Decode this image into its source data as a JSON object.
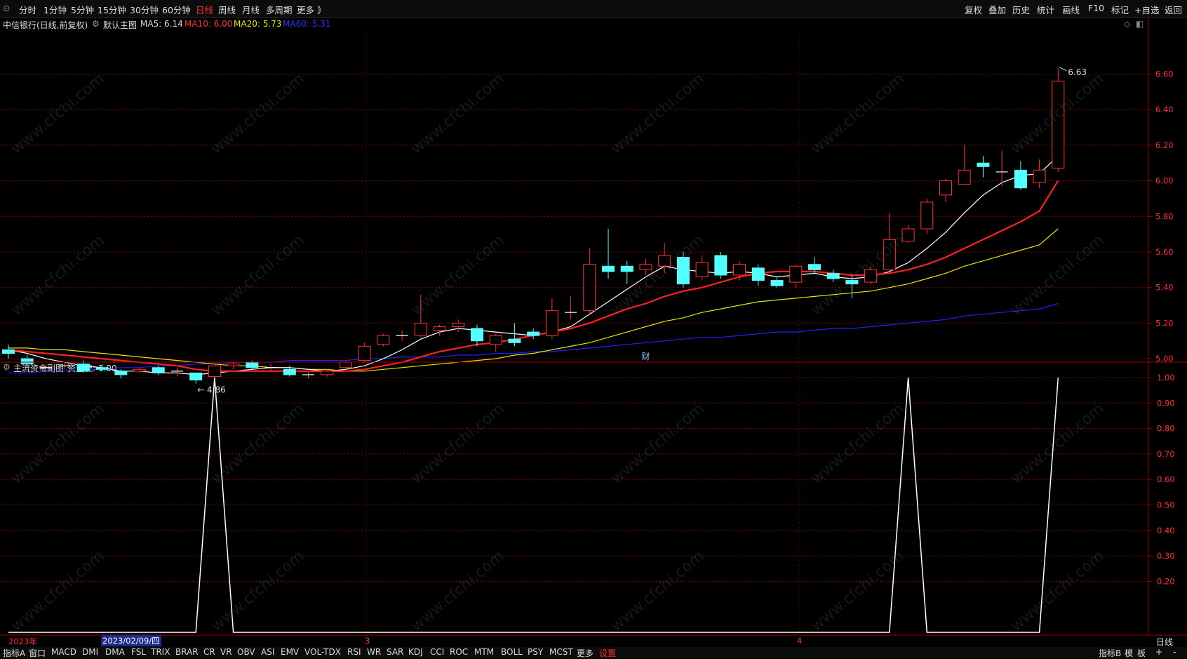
{
  "toolbar": {
    "left_tabs": [
      "分时",
      "1分钟",
      "5分钟",
      "15分钟",
      "30分钟",
      "60分钟",
      "日线",
      "周线",
      "月线",
      "多周期",
      "更多 》"
    ],
    "active_tab": "日线",
    "right_tabs": [
      "复权",
      "叠加",
      "历史",
      "统计",
      "画线",
      "F10",
      "标记",
      "+自选",
      "返回"
    ]
  },
  "main_info": {
    "stock": "中信银行(日线,前复权)",
    "chart_name": "默认主图",
    "ma5": "MA5: 6.14",
    "ma10": "MA10: 6.00",
    "ma20": "MA20: 5.73",
    "ma60": "MA60: 5.31"
  },
  "sub_info": {
    "name": "主流资金副图",
    "value": "资金流: 1.00"
  },
  "annotations": {
    "high": "6.63",
    "low": "4.86",
    "cai": "财"
  },
  "date_axis": {
    "year_label": "2023年",
    "cursor_date": "2023/02/09/四",
    "month_3": "3",
    "month_4": "4",
    "period": "日线"
  },
  "bottom_tabs": [
    "指标A",
    "窗口",
    "MACD",
    "DMI",
    "DMA",
    "FSL",
    "TRIX",
    "BRAR",
    "CR",
    "VR",
    "OBV",
    "ASI",
    "EMV",
    "VOL-TDX",
    "RSI",
    "WR",
    "SAR",
    "KDJ",
    "CCI",
    "ROC",
    "MTM",
    "BOLL",
    "PSY",
    "MCST",
    "更多",
    "设置"
  ],
  "bottom_right_tabs": [
    "指标B",
    "模",
    "板",
    "+",
    "-"
  ],
  "watermark": "www.cfchi.com",
  "colors": {
    "up": "#ff3232",
    "down": "#54ffff",
    "ma5": "#ffffff",
    "ma10": "#ff2020",
    "ma20": "#e6e600",
    "ma60": "#2020ff",
    "grid": "#8a0000"
  },
  "chart_data": [
    {
      "type": "candlestick",
      "title": "中信银行(日线,前复权)",
      "y_ticks": [
        "6.60",
        "6.40",
        "6.20",
        "6.00",
        "5.80",
        "5.60",
        "5.40",
        "5.20",
        "5.00"
      ],
      "ylim": [
        4.84,
        6.64
      ],
      "candles": [
        {
          "o": 5.05,
          "h": 5.08,
          "l": 5.0,
          "c": 5.03
        },
        {
          "o": 5.0,
          "h": 5.02,
          "l": 4.96,
          "c": 4.97
        },
        {
          "o": 4.95,
          "h": 4.97,
          "l": 4.93,
          "c": 4.95
        },
        {
          "o": 4.96,
          "h": 4.98,
          "l": 4.94,
          "c": 4.96
        },
        {
          "o": 4.97,
          "h": 4.99,
          "l": 4.92,
          "c": 4.93
        },
        {
          "o": 4.95,
          "h": 4.97,
          "l": 4.93,
          "c": 4.94
        },
        {
          "o": 4.93,
          "h": 4.94,
          "l": 4.89,
          "c": 4.91
        },
        {
          "o": 4.93,
          "h": 4.95,
          "l": 4.92,
          "c": 4.94
        },
        {
          "o": 4.95,
          "h": 4.96,
          "l": 4.91,
          "c": 4.92
        },
        {
          "o": 4.93,
          "h": 4.95,
          "l": 4.9,
          "c": 4.93
        },
        {
          "o": 4.92,
          "h": 4.92,
          "l": 4.86,
          "c": 4.88
        },
        {
          "o": 4.9,
          "h": 4.97,
          "l": 4.89,
          "c": 4.96
        },
        {
          "o": 4.96,
          "h": 4.98,
          "l": 4.94,
          "c": 4.97
        },
        {
          "o": 4.98,
          "h": 4.99,
          "l": 4.94,
          "c": 4.95
        },
        {
          "o": 4.95,
          "h": 4.97,
          "l": 4.93,
          "c": 4.95
        },
        {
          "o": 4.94,
          "h": 4.96,
          "l": 4.9,
          "c": 4.91
        },
        {
          "o": 4.91,
          "h": 4.93,
          "l": 4.89,
          "c": 4.91
        },
        {
          "o": 4.91,
          "h": 4.94,
          "l": 4.9,
          "c": 4.93
        },
        {
          "o": 4.95,
          "h": 4.99,
          "l": 4.94,
          "c": 4.98
        },
        {
          "o": 4.99,
          "h": 5.09,
          "l": 4.98,
          "c": 5.07
        },
        {
          "o": 5.08,
          "h": 5.14,
          "l": 5.07,
          "c": 5.13
        },
        {
          "o": 5.13,
          "h": 5.16,
          "l": 5.1,
          "c": 5.13
        },
        {
          "o": 5.13,
          "h": 5.36,
          "l": 5.12,
          "c": 5.2
        },
        {
          "o": 5.16,
          "h": 5.19,
          "l": 5.13,
          "c": 5.18
        },
        {
          "o": 5.18,
          "h": 5.22,
          "l": 5.15,
          "c": 5.2
        },
        {
          "o": 5.17,
          "h": 5.19,
          "l": 5.07,
          "c": 5.1
        },
        {
          "o": 5.08,
          "h": 5.14,
          "l": 5.04,
          "c": 5.13
        },
        {
          "o": 5.11,
          "h": 5.2,
          "l": 5.07,
          "c": 5.09
        },
        {
          "o": 5.15,
          "h": 5.17,
          "l": 5.11,
          "c": 5.13
        },
        {
          "o": 5.13,
          "h": 5.34,
          "l": 5.11,
          "c": 5.27
        },
        {
          "o": 5.26,
          "h": 5.35,
          "l": 5.22,
          "c": 5.26
        },
        {
          "o": 5.27,
          "h": 5.62,
          "l": 5.25,
          "c": 5.53
        },
        {
          "o": 5.52,
          "h": 5.73,
          "l": 5.45,
          "c": 5.49
        },
        {
          "o": 5.52,
          "h": 5.55,
          "l": 5.42,
          "c": 5.49
        },
        {
          "o": 5.5,
          "h": 5.56,
          "l": 5.47,
          "c": 5.53
        },
        {
          "o": 5.52,
          "h": 5.65,
          "l": 5.48,
          "c": 5.58
        },
        {
          "o": 5.57,
          "h": 5.6,
          "l": 5.4,
          "c": 5.42
        },
        {
          "o": 5.46,
          "h": 5.58,
          "l": 5.44,
          "c": 5.54
        },
        {
          "o": 5.58,
          "h": 5.6,
          "l": 5.45,
          "c": 5.47
        },
        {
          "o": 5.47,
          "h": 5.55,
          "l": 5.44,
          "c": 5.53
        },
        {
          "o": 5.51,
          "h": 5.53,
          "l": 5.41,
          "c": 5.44
        },
        {
          "o": 5.44,
          "h": 5.46,
          "l": 5.4,
          "c": 5.41
        },
        {
          "o": 5.43,
          "h": 5.53,
          "l": 5.4,
          "c": 5.52
        },
        {
          "o": 5.53,
          "h": 5.57,
          "l": 5.48,
          "c": 5.5
        },
        {
          "o": 5.48,
          "h": 5.5,
          "l": 5.43,
          "c": 5.45
        },
        {
          "o": 5.44,
          "h": 5.47,
          "l": 5.34,
          "c": 5.42
        },
        {
          "o": 5.43,
          "h": 5.52,
          "l": 5.42,
          "c": 5.5
        },
        {
          "o": 5.5,
          "h": 5.82,
          "l": 5.49,
          "c": 5.67
        },
        {
          "o": 5.66,
          "h": 5.75,
          "l": 5.65,
          "c": 5.73
        },
        {
          "o": 5.73,
          "h": 5.9,
          "l": 5.7,
          "c": 5.88
        },
        {
          "o": 5.92,
          "h": 6.01,
          "l": 5.88,
          "c": 6.0
        },
        {
          "o": 5.98,
          "h": 6.2,
          "l": 5.98,
          "c": 6.06
        },
        {
          "o": 6.1,
          "h": 6.14,
          "l": 6.02,
          "c": 6.08
        },
        {
          "o": 6.05,
          "h": 6.17,
          "l": 5.97,
          "c": 6.05
        },
        {
          "o": 6.06,
          "h": 6.11,
          "l": 5.95,
          "c": 5.96
        },
        {
          "o": 5.99,
          "h": 6.12,
          "l": 5.96,
          "c": 6.06
        },
        {
          "o": 6.07,
          "h": 6.63,
          "l": 6.05,
          "c": 6.56
        }
      ],
      "ma5": [
        5.05,
        5.03,
        5.0,
        4.98,
        4.96,
        4.95,
        4.93,
        4.93,
        4.92,
        4.92,
        4.91,
        4.92,
        4.93,
        4.94,
        4.95,
        4.95,
        4.94,
        4.93,
        4.94,
        4.96,
        5.0,
        5.05,
        5.11,
        5.15,
        5.17,
        5.16,
        5.15,
        5.14,
        5.13,
        5.15,
        5.18,
        5.25,
        5.32,
        5.39,
        5.46,
        5.52,
        5.5,
        5.49,
        5.48,
        5.49,
        5.48,
        5.46,
        5.47,
        5.48,
        5.46,
        5.45,
        5.46,
        5.49,
        5.54,
        5.62,
        5.71,
        5.82,
        5.92,
        5.99,
        6.03,
        6.04,
        6.14
      ],
      "ma10": [
        5.05,
        5.04,
        5.03,
        5.02,
        5.01,
        5.0,
        4.99,
        4.98,
        4.97,
        4.96,
        4.94,
        4.93,
        4.93,
        4.93,
        4.93,
        4.93,
        4.93,
        4.93,
        4.93,
        4.94,
        4.96,
        4.98,
        5.01,
        5.04,
        5.06,
        5.08,
        5.09,
        5.11,
        5.13,
        5.15,
        5.17,
        5.2,
        5.24,
        5.28,
        5.31,
        5.35,
        5.38,
        5.4,
        5.43,
        5.46,
        5.48,
        5.49,
        5.49,
        5.49,
        5.48,
        5.47,
        5.47,
        5.48,
        5.5,
        5.53,
        5.57,
        5.62,
        5.67,
        5.72,
        5.77,
        5.83,
        6.0
      ],
      "ma20": [
        5.06,
        5.06,
        5.05,
        5.05,
        5.04,
        5.03,
        5.02,
        5.01,
        5.0,
        4.99,
        4.98,
        4.97,
        4.96,
        4.96,
        4.95,
        4.95,
        4.94,
        4.94,
        4.93,
        4.93,
        4.94,
        4.95,
        4.96,
        4.97,
        4.98,
        4.99,
        5.0,
        5.02,
        5.03,
        5.05,
        5.07,
        5.09,
        5.12,
        5.15,
        5.18,
        5.21,
        5.23,
        5.26,
        5.28,
        5.3,
        5.32,
        5.33,
        5.34,
        5.35,
        5.36,
        5.37,
        5.38,
        5.4,
        5.42,
        5.45,
        5.48,
        5.52,
        5.55,
        5.58,
        5.61,
        5.64,
        5.73
      ],
      "ma60": [
        4.92,
        4.92,
        4.93,
        4.93,
        4.94,
        4.94,
        4.95,
        4.95,
        4.96,
        4.96,
        4.97,
        4.97,
        4.98,
        4.98,
        4.98,
        4.99,
        4.99,
        4.99,
        4.99,
        5.0,
        5.0,
        5.01,
        5.01,
        5.01,
        5.02,
        5.02,
        5.03,
        5.03,
        5.04,
        5.04,
        5.05,
        5.06,
        5.07,
        5.08,
        5.09,
        5.1,
        5.11,
        5.12,
        5.12,
        5.13,
        5.14,
        5.15,
        5.15,
        5.16,
        5.17,
        5.17,
        5.18,
        5.19,
        5.2,
        5.21,
        5.22,
        5.24,
        5.25,
        5.26,
        5.27,
        5.28,
        5.31
      ]
    },
    {
      "type": "line",
      "title": "主流资金副图",
      "series": [
        {
          "name": "资金流",
          "values": [
            0,
            0,
            0,
            0,
            0,
            0,
            0,
            0,
            0,
            0,
            0,
            1,
            0,
            0,
            0,
            0,
            0,
            0,
            0,
            0,
            0,
            0,
            0,
            0,
            0,
            0,
            0,
            0,
            0,
            0,
            0,
            0,
            0,
            0,
            0,
            0,
            0,
            0,
            0,
            0,
            0,
            0,
            0,
            0,
            0,
            0,
            0,
            0,
            1,
            0,
            0,
            0,
            0,
            0,
            0,
            0,
            1
          ]
        }
      ],
      "y_ticks": [
        "1.00",
        "0.90",
        "0.80",
        "0.70",
        "0.60",
        "0.50",
        "0.40",
        "0.30",
        "0.20"
      ],
      "ylim": [
        0,
        1
      ]
    }
  ]
}
